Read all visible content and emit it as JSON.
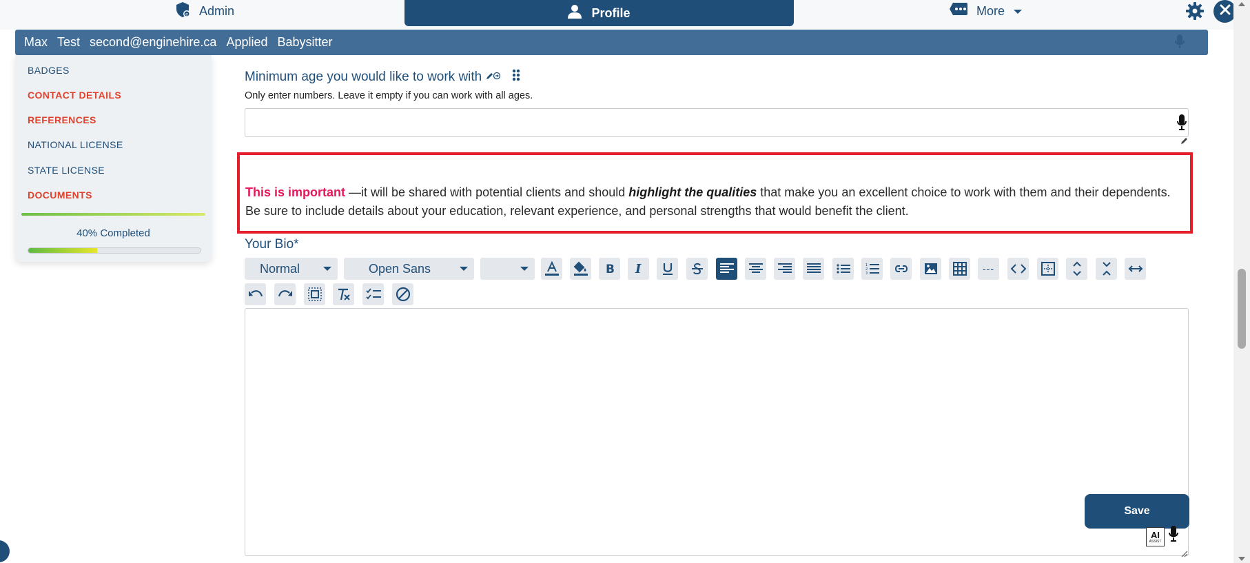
{
  "colors": {
    "primary": "#1f4e79",
    "info_bar": "#426d96",
    "alert_border": "#e21f2a",
    "important_text": "#e4185a",
    "incomplete_section": "#e0432d"
  },
  "nav": {
    "admin_label": "Admin",
    "admin_icon": "shield-icon",
    "profile_label": "Profile",
    "profile_icon": "user-icon",
    "more_label": "More",
    "more_icon": "message-dots-icon",
    "settings_icon": "gear-icon",
    "close_icon": "close-icon"
  },
  "info_bar": {
    "first_name": "Max",
    "last_name": "Test",
    "email": "second@enginehire.ca",
    "status": "Applied",
    "role": "Babysitter"
  },
  "sidebar": {
    "items": [
      {
        "label": "BADGES",
        "state": "complete"
      },
      {
        "label": "CONTACT DETAILS",
        "state": "incomplete"
      },
      {
        "label": "REFERENCES",
        "state": "incomplete"
      },
      {
        "label": "NATIONAL LICENSE",
        "state": "complete"
      },
      {
        "label": "STATE LICENSE",
        "state": "complete"
      },
      {
        "label": "DOCUMENTS",
        "state": "incomplete"
      }
    ],
    "progress_label": "40% Completed",
    "progress_fraction": 0.4
  },
  "min_age_field": {
    "label": "Minimum age you would like to work with",
    "help": "Only enter numbers. Leave it empty if you can work with all ages.",
    "value": ""
  },
  "callout": {
    "important": "This is important",
    "text_before": " —it will be shared with potential clients and should ",
    "highlight": "highlight the qualities",
    "text_after": " that make you an excellent choice to work with them and their dependents. Be sure to include details about your education, relevant experience, and personal strengths that would benefit the client."
  },
  "bio": {
    "label": "Your Bio*",
    "toolbar": {
      "paragraph_style": "Normal",
      "font_family": "Open Sans",
      "font_size": "",
      "horizontal_rule": "---"
    },
    "value": ""
  },
  "save_label": "Save",
  "ai_assist": {
    "main": "AI",
    "sub": "ASSIST"
  }
}
